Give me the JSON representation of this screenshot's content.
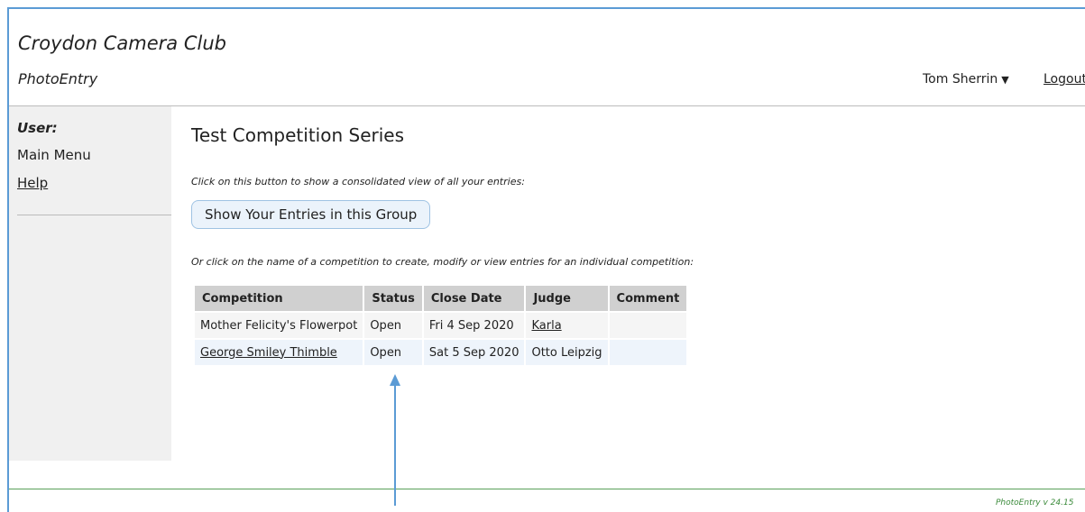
{
  "header": {
    "site_title": "Croydon Camera Club",
    "app_name": "PhotoEntry",
    "user_name": "Tom Sherrin",
    "logout_label": "Logout"
  },
  "sidebar": {
    "user_label": "User:",
    "items": [
      {
        "label": "Main Menu"
      },
      {
        "label": "Help"
      }
    ]
  },
  "main": {
    "title": "Test Competition Series",
    "instruction_1": "Click on this button to show a consolidated view of all your entries:",
    "show_entries_button": "Show Your Entries in this Group",
    "instruction_2": "Or click on the name of a competition to create, modify or view entries for an individual competition:",
    "table": {
      "columns": [
        "Competition",
        "Status",
        "Close Date",
        "Judge",
        "Comment"
      ],
      "rows": [
        {
          "competition": "Mother Felicity's Flowerpot",
          "status": "Open",
          "close_date": "Fri 4 Sep 2020",
          "judge": "Karla",
          "comment": ""
        },
        {
          "competition": "George Smiley Thimble",
          "status": "Open",
          "close_date": "Sat 5 Sep 2020",
          "judge": "Otto Leipzig",
          "comment": ""
        }
      ]
    }
  },
  "footer": {
    "version": "PhotoEntry v 24.15"
  },
  "colors": {
    "frame_border": "#5b9bd5",
    "annotation_arrow": "#5b9bd5",
    "footer_rule": "#5aa05a",
    "version_text": "#3a8a3a",
    "sidebar_bg": "#f0f0f0",
    "button_bg": "#ebf3fb"
  },
  "icons": {
    "user_menu_caret": "caret-down-icon",
    "annotation": "arrow-up-icon"
  }
}
